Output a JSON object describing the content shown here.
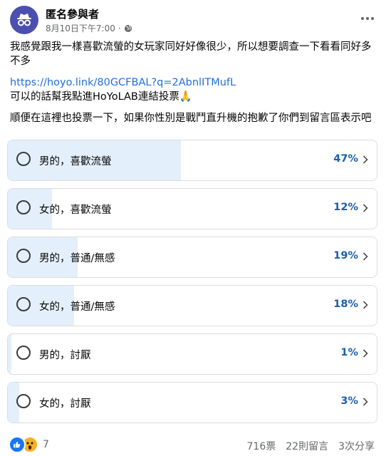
{
  "post": {
    "author": "匿名參與者",
    "timestamp": "8月10日下午7:00",
    "separator": "·",
    "privacy_icon": "globe-icon",
    "more_icon": "more-horizontal-icon"
  },
  "body": {
    "line1": "我感覺跟我一樣喜歡流螢的女玩家同好好像很少，所以想要調查一下看看同好多不多",
    "link": "https://hoyo.link/80GCFBAL?q=2AbnlITMufL",
    "line2": "可以的話幫我點進HoYoLAB連結投票🙏",
    "line3": "順便在這裡也投票一下，如果你性別是戰鬥直升機的抱歉了你們到留言區表示吧"
  },
  "poll": {
    "options": [
      {
        "label": "男的，喜歡流螢",
        "percent_text": "47%",
        "percent": 47
      },
      {
        "label": "女的，喜歡流螢",
        "percent_text": "12%",
        "percent": 12
      },
      {
        "label": "男的，普通/無感",
        "percent_text": "19%",
        "percent": 19
      },
      {
        "label": "女的，普通/無感",
        "percent_text": "18%",
        "percent": 18
      },
      {
        "label": "男的，討厭",
        "percent_text": "1%",
        "percent": 1
      },
      {
        "label": "女的，討厭",
        "percent_text": "3%",
        "percent": 3
      }
    ]
  },
  "footer": {
    "reaction_count": "7",
    "votes": "716票",
    "comments": "22則留言",
    "shares": "3次分享"
  },
  "colors": {
    "bar_fill": "#e3f0fb",
    "percent_text": "#1b5fab",
    "link": "#216fdb",
    "avatar": "#4b4fb0"
  }
}
